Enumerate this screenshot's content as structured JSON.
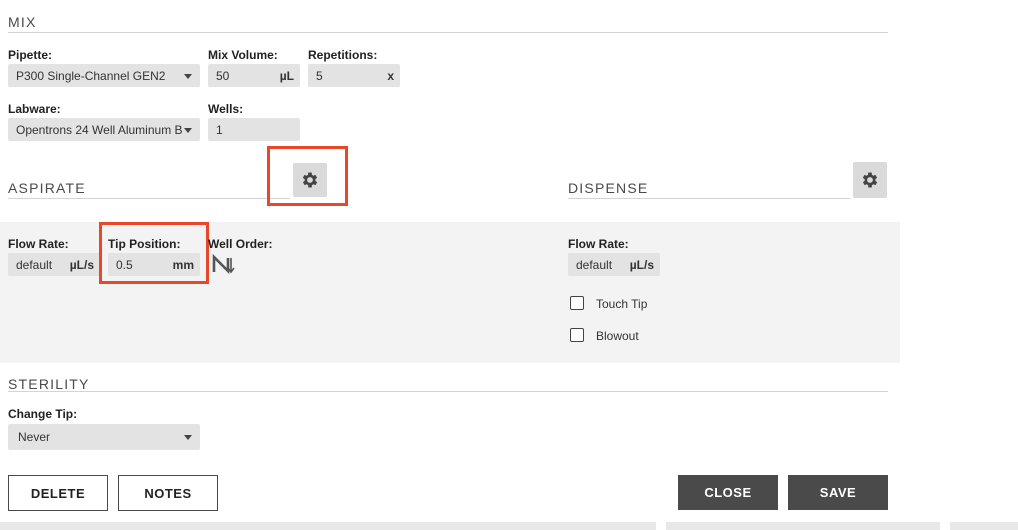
{
  "mix": {
    "title": "MIX",
    "pipette": {
      "label": "Pipette:",
      "value": "P300 Single-Channel GEN2"
    },
    "mix_volume": {
      "label": "Mix Volume:",
      "value": "50",
      "unit": "µL"
    },
    "repetitions": {
      "label": "Repetitions:",
      "value": "5",
      "unit": "x"
    },
    "labware": {
      "label": "Labware:",
      "value": "Opentrons 24 Well Aluminum B"
    },
    "wells": {
      "label": "Wells:",
      "value": "1"
    }
  },
  "aspirate": {
    "title": "ASPIRATE",
    "settings_icon": "gear-icon",
    "flow_rate": {
      "label": "Flow Rate:",
      "value": "default",
      "unit": "µL/s"
    },
    "tip_position": {
      "label": "Tip Position:",
      "value": "0.5",
      "unit": "mm"
    },
    "well_order": {
      "label": "Well Order:",
      "icon": "well-order-icon"
    }
  },
  "dispense": {
    "title": "DISPENSE",
    "settings_icon": "gear-icon",
    "flow_rate": {
      "label": "Flow Rate:",
      "value": "default",
      "unit": "µL/s"
    },
    "touch_tip": {
      "label": "Touch Tip",
      "checked": false
    },
    "blowout": {
      "label": "Blowout",
      "checked": false
    }
  },
  "sterility": {
    "title": "STERILITY",
    "change_tip": {
      "label": "Change Tip:",
      "value": "Never"
    }
  },
  "footer": {
    "delete_label": "DELETE",
    "notes_label": "NOTES",
    "close_label": "CLOSE",
    "save_label": "SAVE"
  },
  "colors": {
    "highlight": "#e8472a",
    "button_dark": "#4a4a4a",
    "field_bg": "#e3e3e3",
    "band_bg": "#f3f3f3"
  }
}
